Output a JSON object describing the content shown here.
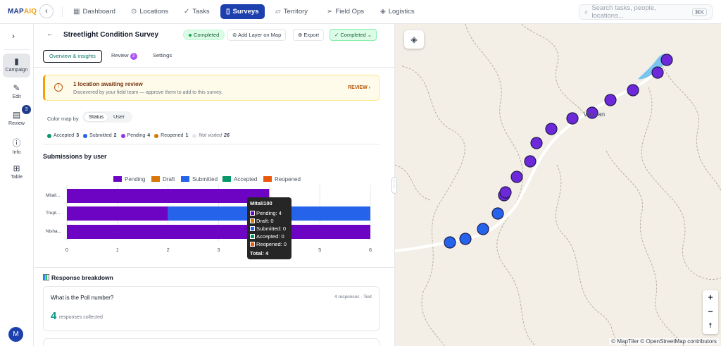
{
  "app": {
    "logo_main": "MAP",
    "logo_accent": "AIQ"
  },
  "topnav": {
    "items": [
      {
        "label": "Dashboard",
        "icon": "grid-icon"
      },
      {
        "label": "Locations",
        "icon": "pin-icon"
      },
      {
        "label": "Tasks",
        "icon": "check-icon"
      },
      {
        "label": "Surveys",
        "icon": "clipboard-icon",
        "active": true
      },
      {
        "label": "Territory",
        "icon": "map-icon"
      },
      {
        "label": "Field Ops",
        "icon": "send-icon"
      },
      {
        "label": "Logistics",
        "icon": "box-icon"
      }
    ],
    "search_placeholder": "Search tasks, people, locations...",
    "search_shortcut": "⌘K"
  },
  "rail": {
    "items": [
      {
        "label": "Campaign",
        "icon": "clipboard-icon"
      },
      {
        "label": "Edit",
        "icon": "edit-icon"
      },
      {
        "label": "Review",
        "icon": "review-icon",
        "badge": "3"
      },
      {
        "label": "Info",
        "icon": "info-icon"
      },
      {
        "label": "Table",
        "icon": "table-icon"
      }
    ],
    "avatar": "M"
  },
  "header": {
    "title": "Streetlight Condition Survey",
    "status": "Completed",
    "add_layer": "Add Layer on Map",
    "export": "Export",
    "status_dropdown": "Completed"
  },
  "tabs": [
    {
      "label": "Overview & insights"
    },
    {
      "label": "Review",
      "badge": "3"
    },
    {
      "label": "Settings"
    }
  ],
  "alert": {
    "title": "1 location awaiting review",
    "description": "Discovered by your field team — approve them to add to this survey.",
    "action": "REVIEW"
  },
  "colormap": {
    "label": "Color map by",
    "options": [
      "Status",
      "User"
    ],
    "selected": "Status"
  },
  "stats": [
    {
      "label": "Accepted",
      "count": "3",
      "color": "#059669"
    },
    {
      "label": "Submitted",
      "count": "2",
      "color": "#2563eb"
    },
    {
      "label": "Pending",
      "count": "4",
      "color": "#9333ea"
    },
    {
      "label": "Reopened",
      "count": "1",
      "color": "#d97706"
    },
    {
      "label": "Not visited",
      "count": "26",
      "color": "#e5e7eb"
    }
  ],
  "submissions_title": "Submissions by user",
  "chart_data": {
    "type": "bar",
    "orientation": "horizontal",
    "stacked": true,
    "categories": [
      "Mitali...",
      "Trupt...",
      "Nisha..."
    ],
    "series": [
      {
        "name": "Pending",
        "color": "#6d04c4",
        "values": [
          4,
          2,
          6
        ]
      },
      {
        "name": "Draft",
        "color": "#d97706",
        "values": [
          0,
          0,
          0
        ]
      },
      {
        "name": "Submitted",
        "color": "#2563eb",
        "values": [
          0,
          4,
          0
        ]
      },
      {
        "name": "Accepted",
        "color": "#059669",
        "values": [
          0,
          0,
          0
        ]
      },
      {
        "name": "Reopened",
        "color": "#ea580c",
        "values": [
          0,
          0,
          0
        ]
      }
    ],
    "xticks": [
      "0",
      "1",
      "2",
      "3",
      "4",
      "5",
      "6"
    ],
    "xlim": [
      0,
      6
    ]
  },
  "tooltip": {
    "title": "Mitali100",
    "rows": [
      "Pending: 4",
      "Draft: 0",
      "Submitted: 0",
      "Accepted: 0",
      "Reopened: 0"
    ],
    "total": "Total: 4"
  },
  "breakdown": {
    "title": "Response breakdown",
    "question": "What is the Poll number?",
    "meta": "4 responses · Text",
    "count": "4",
    "count_label": "responses collected"
  },
  "map": {
    "place": "Wa van",
    "attribution": "© MapTiler © OpenStreetMap contributors",
    "markers": [
      {
        "status": "submitted"
      },
      {
        "status": "submitted"
      },
      {
        "status": "submitted"
      },
      {
        "status": "submitted"
      },
      {
        "status": "pending"
      },
      {
        "status": "pending"
      },
      {
        "status": "pending"
      },
      {
        "status": "pending"
      },
      {
        "status": "pending"
      },
      {
        "status": "pending"
      },
      {
        "status": "pending"
      },
      {
        "status": "pending"
      },
      {
        "status": "pending"
      },
      {
        "status": "pending"
      },
      {
        "status": "pending"
      },
      {
        "status": "pending"
      }
    ],
    "marker_colors": {
      "pending": "#6d28d9",
      "submitted": "#2563eb"
    }
  }
}
